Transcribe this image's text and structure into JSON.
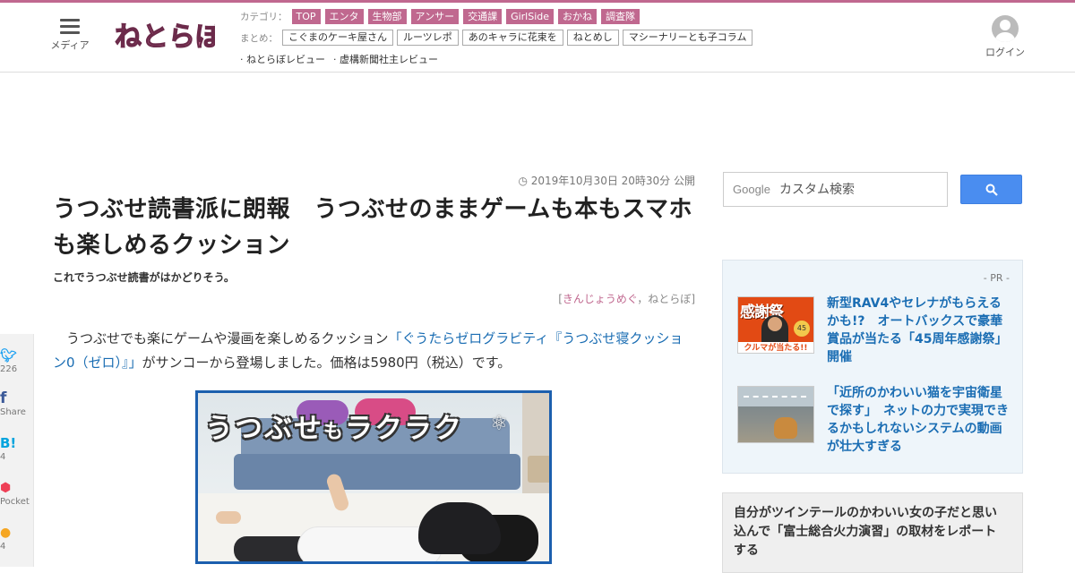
{
  "header": {
    "menu_label": "メディア",
    "logo_text": "ねとらぼ",
    "category_label": "カテゴリ：",
    "categories": [
      "TOP",
      "エンタ",
      "生物部",
      "アンサー",
      "交通課",
      "GirlSide",
      "おかね",
      "調査隊"
    ],
    "summary_label": "まとめ：",
    "summaries": [
      "こぐまのケーキ屋さん",
      "ルーツレポ",
      "あのキャラに花束を",
      "ねとめし",
      "マシーナリーとも子コラム"
    ],
    "reviews": [
      "ねとらぼレビュー",
      "虚構新聞社主レビュー"
    ],
    "login_label": "ログイン"
  },
  "share": [
    {
      "icon": "twitter-icon",
      "glyph": "🐦",
      "count": "226",
      "color": "#1da1f2"
    },
    {
      "icon": "facebook-icon",
      "glyph": "f",
      "count": "Share",
      "color": "#3b5998"
    },
    {
      "icon": "hatena-icon",
      "glyph": "B!",
      "count": "4",
      "color": "#00a4de"
    },
    {
      "icon": "pocket-icon",
      "glyph": "⬢",
      "count": "Pocket",
      "color": "#ee4056"
    },
    {
      "icon": "comment-icon",
      "glyph": "●",
      "count": "4",
      "color": "#f5a623"
    }
  ],
  "article": {
    "date": "2019年10月30日 20時30分 公開",
    "title": "うつぶせ読書派に朗報　うつぶせのままゲームも本もスマホも楽しめるクッション",
    "subtitle": "これでうつぶせ読書がはかどりそう。",
    "author_name": "きんじょうめぐ",
    "author_sep": "，",
    "author_site": "ねとらぼ",
    "body_pre": "うつぶせでも楽にゲームや漫画を楽しめるクッション",
    "body_link": "「ぐうたらゼログラビティ『うつぶせ寝クッション0（ゼロ）』」",
    "body_post": "がサンコーから登場しました。価格は5980円（税込）です。",
    "hero_caption_a": "うつぶせ",
    "hero_caption_b": "も",
    "hero_caption_c": "ラクラク"
  },
  "sidebar": {
    "search_brand": "Google",
    "search_placeholder": "カスタム検索",
    "pr_label": "- PR -",
    "pr_items": [
      {
        "text": "新型RAV4やセレナがもらえるかも!?　オートバックスで豪華賞品が当たる「45周年感謝祭」開催",
        "thumb_title": "感謝祭",
        "thumb_sub": "クルマが当たる!!"
      },
      {
        "text": "「近所のかわいい猫を宇宙衛星で探す」　ネットの力で実現できるかもしれないシステムの動画が壮大すぎる"
      }
    ],
    "box2_text": "自分がツインテールのかわいい女の子だと思い込んで「富士総合火力演習」の取材をレポートする"
  }
}
